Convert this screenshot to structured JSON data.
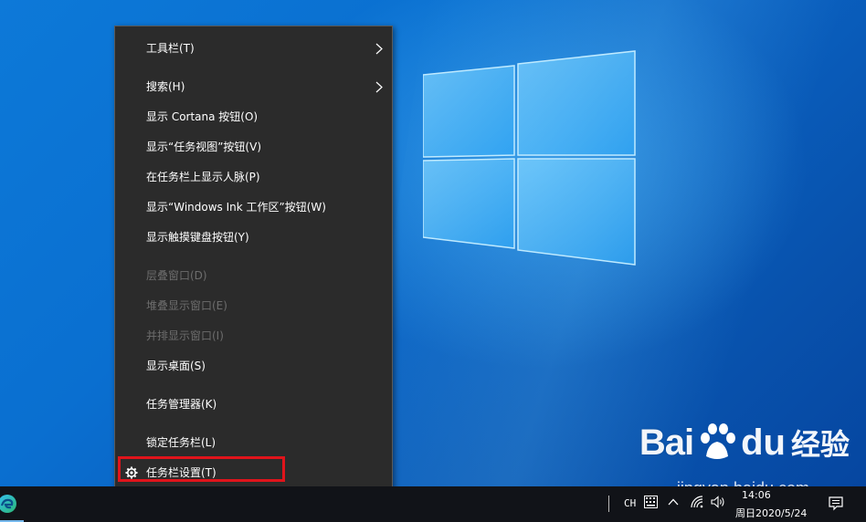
{
  "context_menu": {
    "items": [
      {
        "label": "工具栏(T)",
        "submenu": true,
        "enabled": true
      },
      {
        "label": "搜索(H)",
        "submenu": true,
        "enabled": true
      },
      {
        "label": "显示 Cortana 按钮(O)",
        "enabled": true
      },
      {
        "label": "显示“任务视图”按钮(V)",
        "enabled": true
      },
      {
        "label": "在任务栏上显示人脉(P)",
        "enabled": true
      },
      {
        "label": "显示“Windows Ink 工作区”按钮(W)",
        "enabled": true
      },
      {
        "label": "显示触摸键盘按钮(Y)",
        "enabled": true
      },
      {
        "label": "层叠窗口(D)",
        "enabled": false
      },
      {
        "label": "堆叠显示窗口(E)",
        "enabled": false
      },
      {
        "label": "并排显示窗口(I)",
        "enabled": false
      },
      {
        "label": "显示桌面(S)",
        "enabled": true
      },
      {
        "label": "任务管理器(K)",
        "enabled": true
      },
      {
        "label": "锁定任务栏(L)",
        "enabled": true
      },
      {
        "label": "任务栏设置(T)",
        "enabled": true,
        "icon": "gear-icon",
        "highlighted": true
      }
    ],
    "highlight_color": "#e0141b"
  },
  "taskbar": {
    "input_indicator": "CH",
    "time": "14:06",
    "date": "周日2020/5/24",
    "tray_icons": [
      "keyboard-icon",
      "chevron-up-icon",
      "network-icon",
      "volume-icon",
      "notification-icon"
    ],
    "pinned": [
      "edge-icon"
    ]
  },
  "watermark": {
    "brand_left": "Bai",
    "brand_right": "du",
    "suffix": "经验",
    "url": "jingyan.baidu.com"
  },
  "colors": {
    "menu_bg": "#2b2b2b",
    "taskbar_bg": "#111318",
    "desktop_accent": "#0a6fd0"
  }
}
